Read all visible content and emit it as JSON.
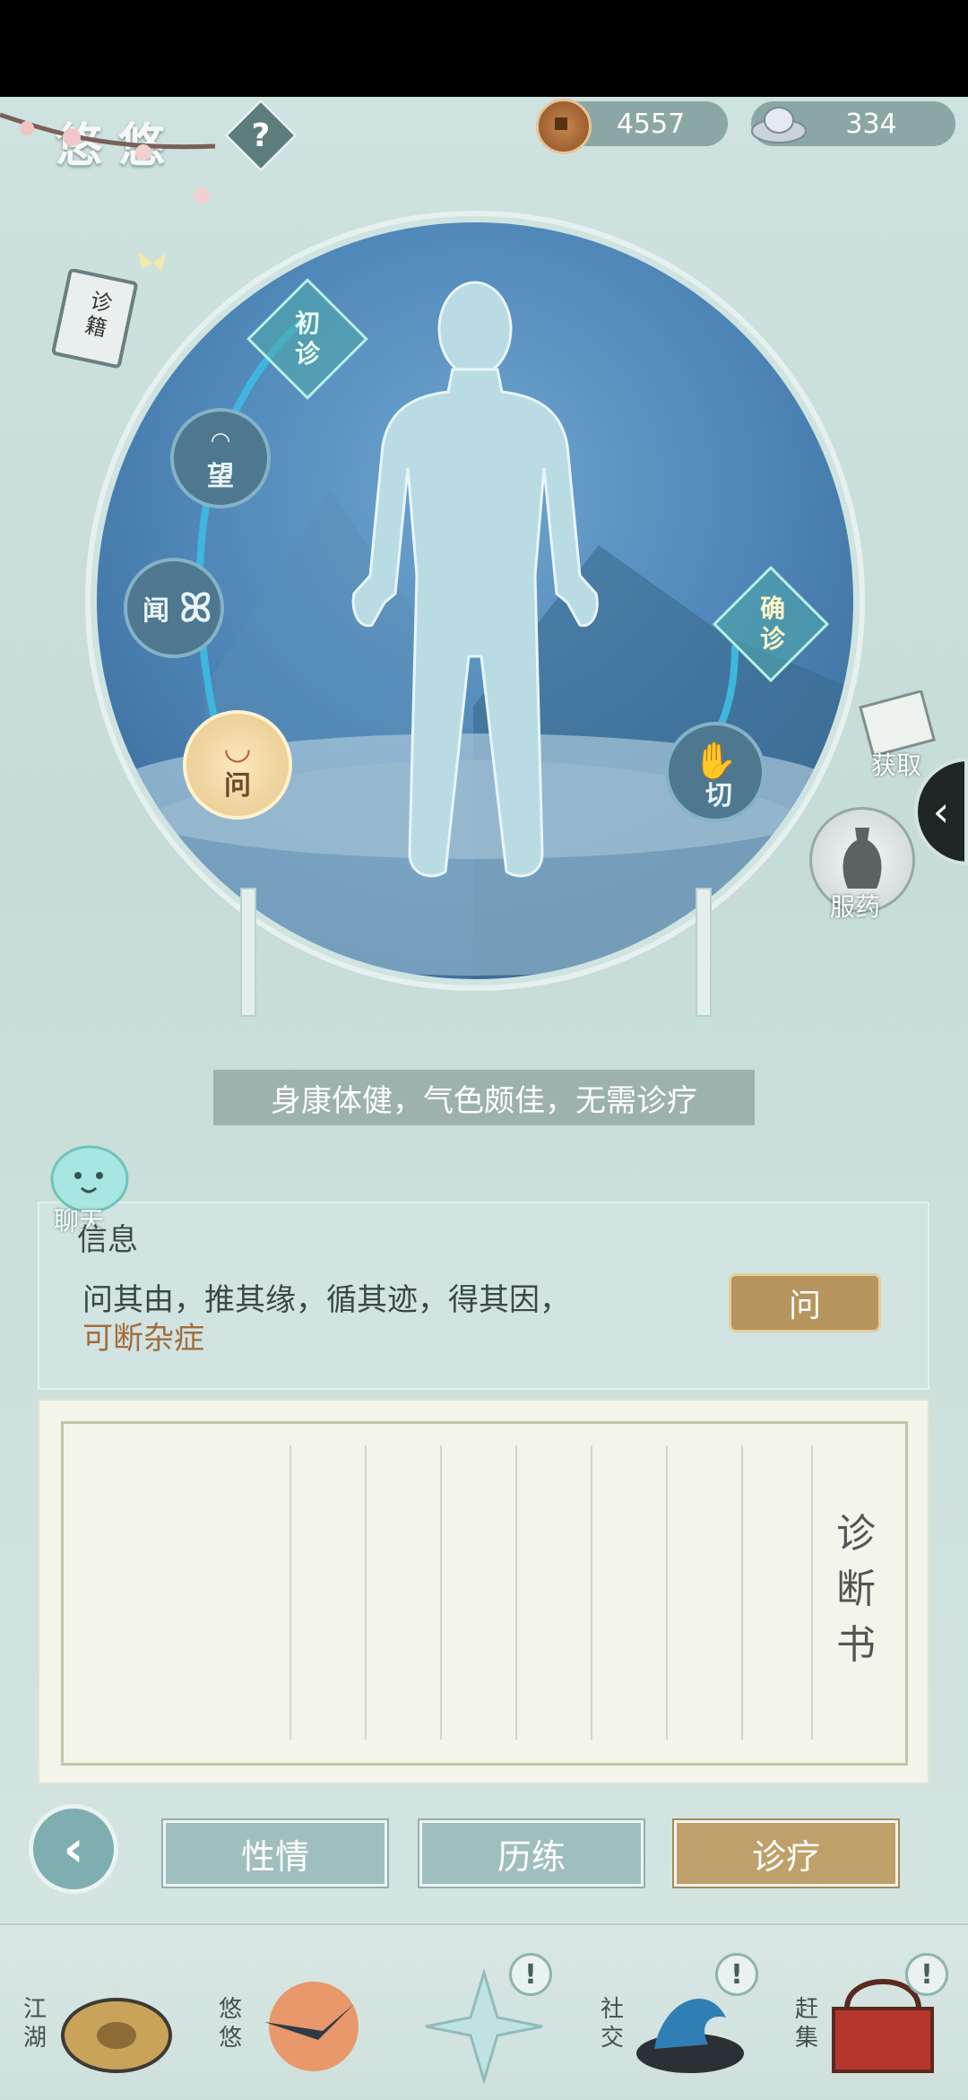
{
  "header": {
    "player_name": "悠悠",
    "help_label": "?",
    "copper_coins": "4557",
    "silver": "334"
  },
  "sidebar": {
    "book_label": "诊籍"
  },
  "diagnosis_steps": {
    "initial": "初诊",
    "look": "望",
    "listen": "闻",
    "ask": "问",
    "confirm": "确诊",
    "pulse": "切"
  },
  "side_actions": {
    "obtain": "获取",
    "medicine": "服药"
  },
  "status_caption": "身康体健，气色颇佳，无需诊疗",
  "chat": {
    "label": "聊天"
  },
  "info": {
    "title": "信息",
    "line1": "问其由，推其缘，循其迹，得其因，",
    "line2": "可断杂症",
    "ask_button": "问"
  },
  "diagnosis_paper": {
    "title": "诊断书"
  },
  "tabs": [
    {
      "label": "性情",
      "active": false
    },
    {
      "label": "历练",
      "active": false
    },
    {
      "label": "诊疗",
      "active": true
    }
  ],
  "nav": {
    "jianghu": "江湖",
    "youyou": "悠悠",
    "shejiao": "社交",
    "ganji": "赶集",
    "alert": "!"
  },
  "colors": {
    "accent_gold": "#c0a06a",
    "tab_teal": "#9fbfbe",
    "circle_blue": "#4f87b8",
    "warning_text": "#a26d3c"
  }
}
